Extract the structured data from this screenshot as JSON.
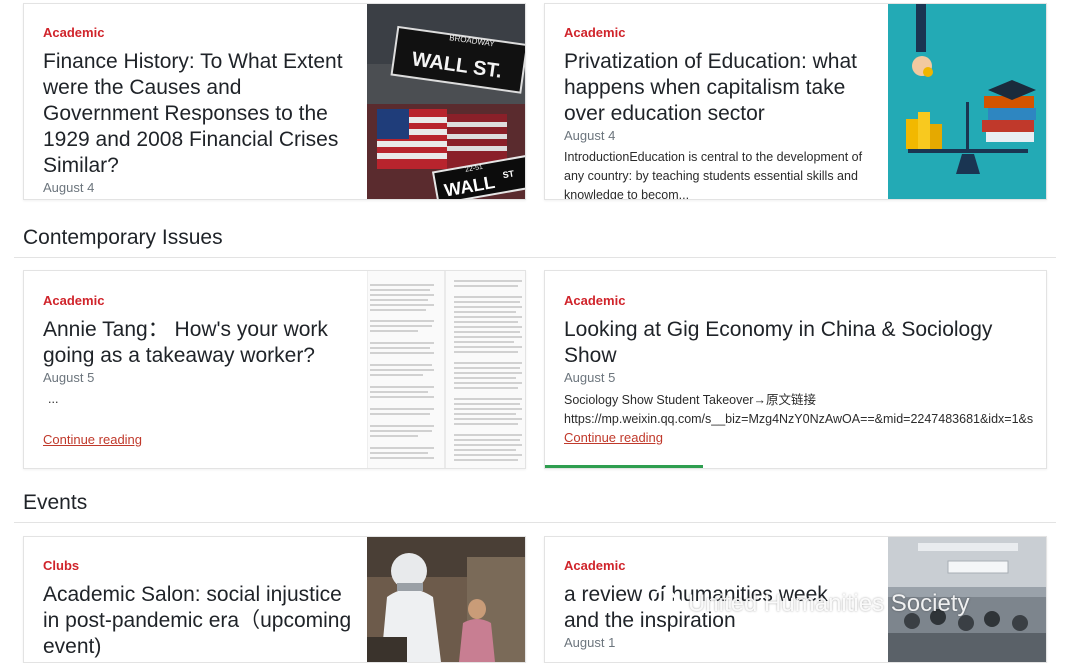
{
  "cards": [
    {
      "category": "Academic",
      "title": "Finance History: To What Extent were the Causes and Government Responses to the 1929 and 2008 Financial Crises Similar?",
      "date": "August 4"
    },
    {
      "category": "Academic",
      "title": "Privatization of Education: what happens when capitalism take over education sector",
      "date": "August 4",
      "excerpt": "IntroductionEducation is central to the development of any country: by teaching students essential skills and knowledge to becom..."
    },
    {
      "category": "Academic",
      "title": "Annie Tang： How's your work going as a takeaway worker?",
      "date": "August 5",
      "excerpt": "...",
      "more": "Continue reading"
    },
    {
      "category": "Academic",
      "title": "Looking at Gig Economy in China & Sociology Show",
      "date": "August 5",
      "excerpt1": "Sociology Show Student Takeover→原文链接",
      "excerpt2": "https://mp.weixin.qq.com/s__biz=Mzg4NzY0NzAwOA==&mid=2247483681&idx=1&s",
      "more": "Continue reading"
    },
    {
      "category": "Clubs",
      "title": "Academic Salon: social injustice in post-pandemic era（upcoming event)"
    },
    {
      "category": "Academic",
      "title": "a review of humanities week and the inspiration",
      "date": "August 1"
    }
  ],
  "sections": {
    "contemporary": "Contemporary Issues",
    "events": "Events"
  },
  "images": {
    "wallst_sign1": "WALL ST.",
    "wallst_sign1_top": "BROADWAY",
    "wallst_sign2": "WALL",
    "wallst_sign2_st": "ST",
    "wallst_sign2_num": "22-51"
  },
  "watermark": "United Humanities Society",
  "colors": {
    "accent": "#d0242b",
    "teal": "#23aab5",
    "progress": "#2e9e4f"
  }
}
